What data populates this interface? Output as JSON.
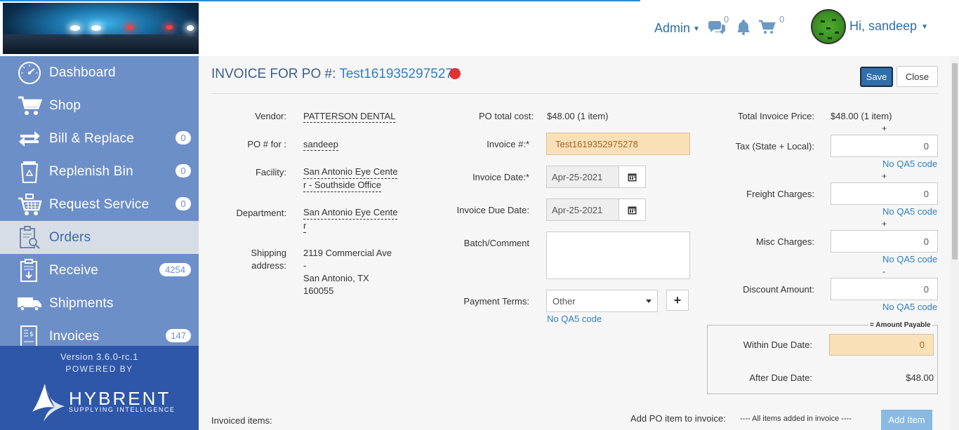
{
  "header": {
    "admin_label": "Admin",
    "messages_count": "0",
    "cart_count": "0",
    "user_greeting": "Hi, sandeep"
  },
  "sidebar": {
    "items": [
      {
        "label": "Dashboard",
        "icon": "dashboard-icon",
        "badge": ""
      },
      {
        "label": "Shop",
        "icon": "cart-icon",
        "badge": ""
      },
      {
        "label": "Bill & Replace",
        "icon": "exchange-icon",
        "badge": "0"
      },
      {
        "label": "Replenish Bin",
        "icon": "recycle-bin-icon",
        "badge": "0"
      },
      {
        "label": "Request Service",
        "icon": "service-cart-icon",
        "badge": "0"
      },
      {
        "label": "Orders",
        "icon": "orders-icon",
        "badge": ""
      },
      {
        "label": "Receive",
        "icon": "receive-icon",
        "badge": "4254"
      },
      {
        "label": "Shipments",
        "icon": "truck-icon",
        "badge": ""
      },
      {
        "label": "Invoices",
        "icon": "invoice-icon",
        "badge": "147"
      }
    ],
    "version": "Version 3.6.0-rc.1",
    "powered_by": "POWERED BY",
    "brand": "HYBRENT",
    "tagline": "SUPPLYING INTELLIGENCE",
    "active_color": "#d6dde7",
    "item_color": "#6d8fc8"
  },
  "page": {
    "title_prefix": "INVOICE FOR PO #:",
    "po_number": "Test1619352975278",
    "save_label": "Save",
    "close_label": "Close"
  },
  "left_col": {
    "vendor_label": "Vendor:",
    "vendor_value": "PATTERSON DENTAL",
    "po_for_label": "PO # for :",
    "po_for_value": "sandeep",
    "facility_label": "Facility:",
    "facility_line1": "San Antonio Eye Cente",
    "facility_line2": "r - Southside Office",
    "department_label": "Department:",
    "department_line1": "San Antonio Eye Cente",
    "department_line2": "r",
    "shipping_label_1": "Shipping",
    "shipping_label_2": "address:",
    "shipping_line1": "2119 Commercial Ave",
    "shipping_line2": "-",
    "shipping_line3": "San Antonio, TX",
    "shipping_line4": "160055"
  },
  "mid_col": {
    "po_total_label": "PO total cost:",
    "po_total_value": "$48.00 (1 item)",
    "invoice_no_label": "Invoice #:*",
    "invoice_no_value": "Test1619352975278",
    "invoice_date_label": "Invoice Date:*",
    "invoice_date_value": "Apr-25-2021",
    "invoice_due_label": "Invoice Due Date:",
    "invoice_due_value": "Apr-25-2021",
    "batch_label": "Batch/Comment",
    "batch_value": "",
    "payment_terms_label": "Payment Terms:",
    "payment_terms_value": "Other",
    "payment_qa5": "No QA5 code"
  },
  "right_col": {
    "total_label": "Total Invoice Price:",
    "total_value": "$48.00 (1 item)",
    "plus_1": "+",
    "tax_label": "Tax (State + Local):",
    "tax_value": "0",
    "tax_qa5": "No QA5 code",
    "plus_2": "+",
    "freight_label": "Freight Charges:",
    "freight_value": "0",
    "freight_qa5": "No QA5 code",
    "plus_3": "+",
    "misc_label": "Misc Charges:",
    "misc_value": "0",
    "misc_qa5": "No QA5 code",
    "minus": "-",
    "discount_label": "Discount Amount:",
    "discount_value": "0",
    "discount_qa5": "No QA5 code",
    "amount_payable_legend": "= Amount Payable",
    "within_due_label": "Within Due Date:",
    "within_due_value": "0",
    "after_due_label": "After Due Date:",
    "after_due_value": "$48.00"
  },
  "footer_row": {
    "invoiced_items_label": "Invoiced items:",
    "add_po_item_label": "Add PO item to invoice:",
    "all_items_text": "---- All items added in invoice ----",
    "add_item_label": "Add Item"
  }
}
